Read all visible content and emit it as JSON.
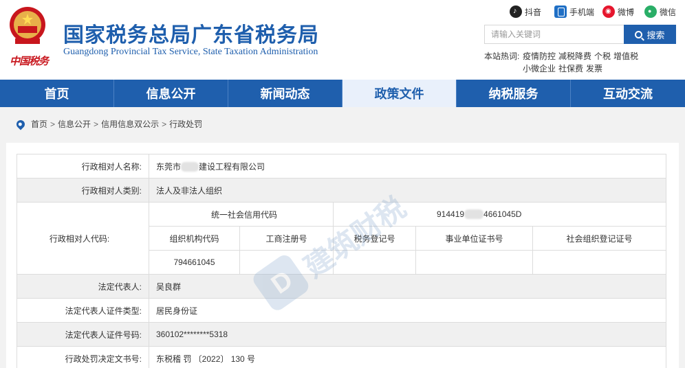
{
  "header": {
    "emblem_text": "中国税务",
    "title_cn": "国家税务总局广东省税务局",
    "title_en": "Guangdong Provincial Tax Service, State Taxation Administration",
    "social": [
      {
        "label": "抖音",
        "icon": "douyin-icon"
      },
      {
        "label": "手机端",
        "icon": "mobile-icon"
      },
      {
        "label": "微博",
        "icon": "weibo-icon"
      },
      {
        "label": "微信",
        "icon": "weixin-icon"
      }
    ],
    "search": {
      "placeholder": "请输入关键词",
      "button": "搜索"
    },
    "hot": {
      "label": "本站热词:",
      "items": [
        "疫情防控",
        "减税降费",
        "个税",
        "增值税",
        "小微企业",
        "社保费",
        "发票"
      ]
    }
  },
  "nav": [
    {
      "label": "首页",
      "active": false
    },
    {
      "label": "信息公开",
      "active": false
    },
    {
      "label": "新闻动态",
      "active": false
    },
    {
      "label": "政策文件",
      "active": true
    },
    {
      "label": "纳税服务",
      "active": false
    },
    {
      "label": "互动交流",
      "active": false
    }
  ],
  "breadcrumb": [
    "首页",
    "信息公开",
    "信用信息双公示",
    "行政处罚"
  ],
  "record": {
    "name_label": "行政相对人名称:",
    "name_prefix": "东莞市",
    "name_suffix": "建设工程有限公司",
    "type_label": "行政相对人类别:",
    "type_value": "法人及非法人组织",
    "code_label": "行政相对人代码:",
    "uscc_label": "统一社会信用代码",
    "uscc_prefix": "914419",
    "uscc_suffix": "4661045D",
    "sub_headers": [
      "组织机构代码",
      "工商注册号",
      "税务登记号",
      "事业单位证书号",
      "社会组织登记证号"
    ],
    "org_code": "794661045",
    "rep_label": "法定代表人:",
    "rep_value": "吴良群",
    "id_type_label": "法定代表人证件类型:",
    "id_type_value": "居民身份证",
    "id_no_label": "法定代表人证件号码:",
    "id_no_value": "360102********5318",
    "doc_label": "行政处罚决定文书号:",
    "doc_value": "东税稽 罚 〔2022〕 130 号"
  },
  "watermark": "建筑财税",
  "colors": {
    "brand_blue": "#1f5fad",
    "emblem_red": "#c8161d",
    "nav_active_bg": "#e9f0fb"
  }
}
